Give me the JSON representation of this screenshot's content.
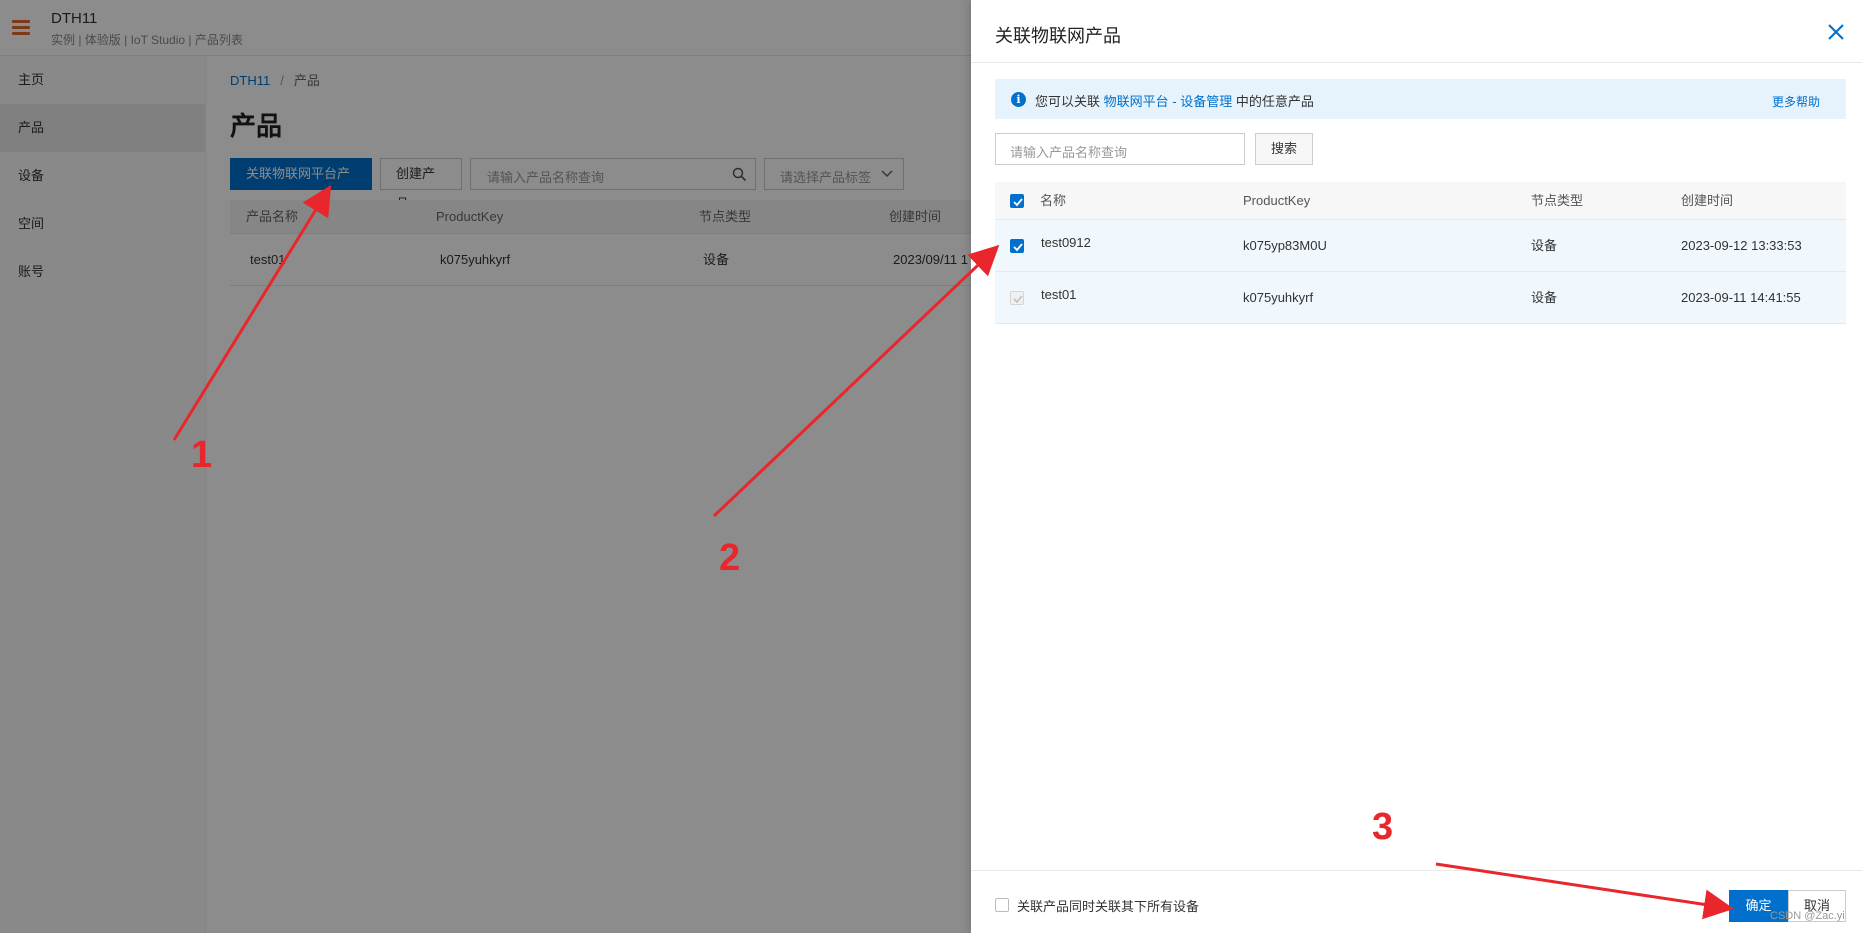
{
  "app": {
    "title": "DTH11",
    "subtitle": "实例 | 体验版 | IoT Studio | 产品列表"
  },
  "sidebar": {
    "items": [
      {
        "label": "主页"
      },
      {
        "label": "产品"
      },
      {
        "label": "设备"
      },
      {
        "label": "空间"
      },
      {
        "label": "账号"
      }
    ],
    "active_index": 1
  },
  "main": {
    "breadcrumb": {
      "root": "DTH11",
      "separator": "/",
      "current": "产品"
    },
    "page_title": "产品",
    "toolbar": {
      "link_button": "关联物联网平台产品",
      "create_button": "创建产品",
      "search_placeholder": "请输入产品名称查询",
      "tag_placeholder": "请选择产品标签"
    },
    "table": {
      "headers": [
        "产品名称",
        "ProductKey",
        "节点类型",
        "创建时间"
      ],
      "rows": [
        {
          "name": "test01",
          "key": "k075yuhkyrf",
          "type": "设备",
          "time": "2023/09/11 1"
        }
      ]
    }
  },
  "drawer": {
    "title": "关联物联网产品",
    "info": {
      "prefix": "您可以关联",
      "link": "物联网平台 - 设备管理",
      "suffix": "中的任意产品",
      "help": "更多帮助"
    },
    "search_placeholder": "请输入产品名称查询",
    "search_button": "搜索",
    "table": {
      "headers": [
        "名称",
        "ProductKey",
        "节点类型",
        "创建时间"
      ],
      "rows": [
        {
          "name": "test0912",
          "key": "k075yp83M0U",
          "type": "设备",
          "time": "2023-09-12 13:33:53",
          "state": "checked"
        },
        {
          "name": "test01",
          "key": "k075yuhkyrf",
          "type": "设备",
          "time": "2023-09-11 14:41:55",
          "state": "disabled"
        }
      ]
    },
    "footer": {
      "checkbox_label": "关联产品同时关联其下所有设备",
      "ok": "确定",
      "cancel": "取消"
    }
  },
  "annotations": {
    "numbers": [
      "1",
      "2",
      "3"
    ],
    "color": "#e8262b"
  },
  "watermark": "CSDN @Zac.yi",
  "colors": {
    "primary": "#0070cc",
    "accent": "#e8692a"
  }
}
